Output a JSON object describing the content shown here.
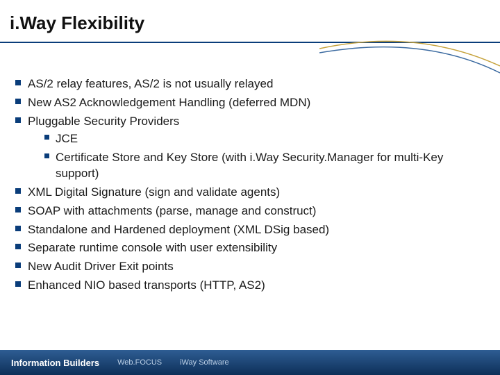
{
  "title": "i.Way Flexibility",
  "bullets": {
    "b0": "AS/2 relay features, AS/2 is not usually relayed",
    "b1": "New AS2 Acknowledgement Handling (deferred MDN)",
    "b2": "Pluggable Security Providers",
    "sub": {
      "s0": "JCE",
      "s1": "Certificate Store and Key Store (with i.Way Security.Manager for multi-Key support)"
    },
    "b3": "XML Digital Signature (sign and validate agents)",
    "b4": "SOAP with attachments (parse, manage and construct)",
    "b5": "Standalone and Hardened deployment (XML DSig based)",
    "b6": "Separate runtime console with user extensibility",
    "b7": "New Audit Driver Exit points",
    "b8": "Enhanced NIO based transports (HTTP, AS2)"
  },
  "footer": {
    "brand_main": "Information Builders",
    "brand2": "Web.FOCUS",
    "brand3": "iWay Software"
  },
  "colors": {
    "accent": "#0a3d7a",
    "swoosh_gold": "#c6a23b",
    "swoosh_blue": "#3b6aa0"
  }
}
